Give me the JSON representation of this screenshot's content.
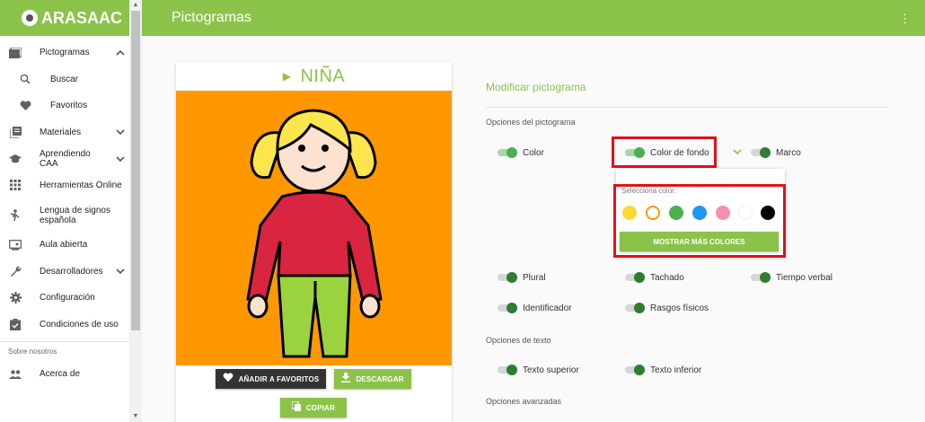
{
  "app": {
    "logo_text": "ARASAAC",
    "page_title": "Pictogramas"
  },
  "sidebar": {
    "items": [
      {
        "label": "Pictogramas",
        "icon": "image-icon",
        "chevron": "⌃"
      },
      {
        "label": "Buscar",
        "icon": "search-icon"
      },
      {
        "label": "Favoritos",
        "icon": "heart-icon"
      },
      {
        "label": "Materiales",
        "icon": "library-icon",
        "chevron": "⌄"
      },
      {
        "label": "Aprendiendo CAA",
        "icon": "school-icon",
        "chevron": "⌄"
      },
      {
        "label": "Herramientas Online",
        "icon": "apps-grid-icon"
      },
      {
        "label": "Lengua de signos española",
        "icon": "sign-language-icon"
      },
      {
        "label": "Aula abierta",
        "icon": "classroom-icon"
      },
      {
        "label": "Desarrolladores",
        "icon": "wrench-icon",
        "chevron": "⌄"
      },
      {
        "label": "Configuración",
        "icon": "gear-icon"
      },
      {
        "label": "Condiciones de uso",
        "icon": "checklist-icon"
      }
    ],
    "section_label": "Sobre nosotros",
    "about_label": "Acerca de"
  },
  "picto": {
    "word": "NIÑA",
    "background_color": "#ff9800",
    "fav_label": "AÑADIR A FAVORITOS",
    "download_label": "DESCARGAR",
    "copy_label": "COPIAR"
  },
  "options": {
    "title": "Modificar pictograma",
    "picto_section": "Opciones del pictograma",
    "color_label": "Color",
    "bg_color_label": "Color de fondo",
    "frame_label": "Marco",
    "select_color_label": "Selecciona color:",
    "colors": [
      "#fdd835",
      "#ff9800",
      "#4caf50",
      "#2196f3",
      "#f48fb1",
      "#ffffff",
      "#000000"
    ],
    "more_colors_label": "MOSTRAR MÁS COLORES",
    "plural_label": "Plural",
    "strike_label": "Tachado",
    "verb_tense_label": "Tiempo verbal",
    "identifier_label": "Identificador",
    "physical_label": "Rasgos físicos",
    "text_section": "Opciones de texto",
    "top_text_label": "Texto superior",
    "bottom_text_label": "Texto inferior",
    "advanced_section": "Opciones avanzadas"
  },
  "colors": {
    "brand_green": "#8bc34a",
    "highlight_red": "#e0111b"
  }
}
